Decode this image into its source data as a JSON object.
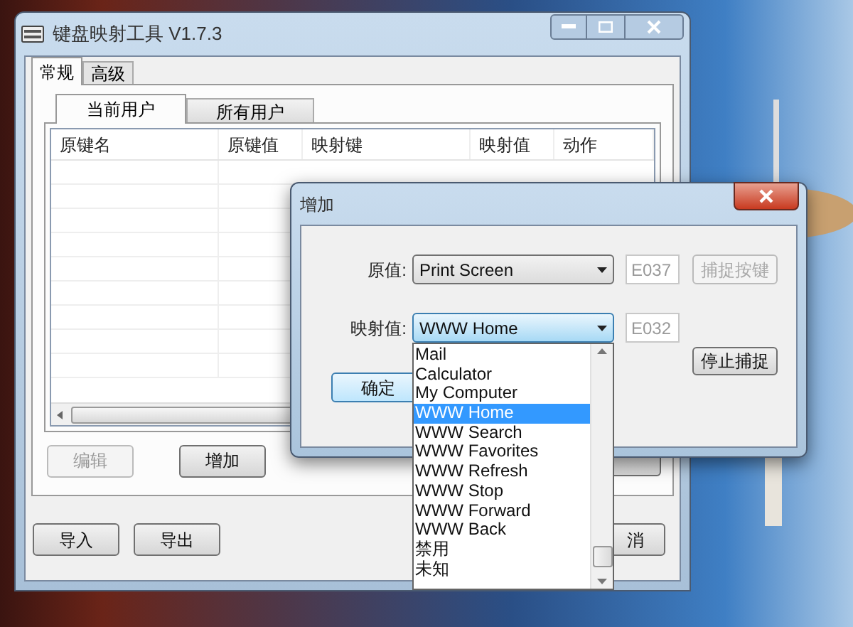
{
  "main_window": {
    "title": "键盘映射工具 V1.7.3",
    "tabs": [
      {
        "label": "常规",
        "selected": true
      },
      {
        "label": "高级",
        "selected": false
      }
    ],
    "subtabs": [
      {
        "label": "当前用户",
        "selected": true
      },
      {
        "label": "所有用户",
        "selected": false
      }
    ],
    "table": {
      "columns": [
        "原键名",
        "原键值",
        "映射键",
        "映射值",
        "动作"
      ]
    },
    "panel_buttons": [
      {
        "label": "编辑",
        "disabled": true
      },
      {
        "label": "增加",
        "disabled": false
      }
    ],
    "footer_buttons": [
      {
        "label": "导入"
      },
      {
        "label": "导出"
      }
    ],
    "cancel_button_visible_text": "消"
  },
  "dialog": {
    "title": "增加",
    "fields": [
      {
        "label": "原值:",
        "value": "Print Screen",
        "code": "E037",
        "focused": false
      },
      {
        "label": "映射值:",
        "value": "WWW Home",
        "code": "E032",
        "focused": true
      }
    ],
    "capture_button": {
      "label": "捕捉按键",
      "disabled": true
    },
    "stop_button": {
      "label": "停止捕捉",
      "disabled": false
    },
    "ok_button": {
      "label": "确定"
    },
    "dropdown": {
      "items": [
        {
          "label": "Mail",
          "selected": false
        },
        {
          "label": "Calculator",
          "selected": false
        },
        {
          "label": "My Computer",
          "selected": false
        },
        {
          "label": "WWW Home",
          "selected": true
        },
        {
          "label": "WWW Search",
          "selected": false
        },
        {
          "label": "WWW Favorites",
          "selected": false
        },
        {
          "label": "WWW Refresh",
          "selected": false
        },
        {
          "label": "WWW Stop",
          "selected": false
        },
        {
          "label": "WWW Forward",
          "selected": false
        },
        {
          "label": "WWW Back",
          "selected": false
        },
        {
          "label": "禁用",
          "selected": false
        },
        {
          "label": "未知",
          "selected": false
        }
      ]
    }
  }
}
